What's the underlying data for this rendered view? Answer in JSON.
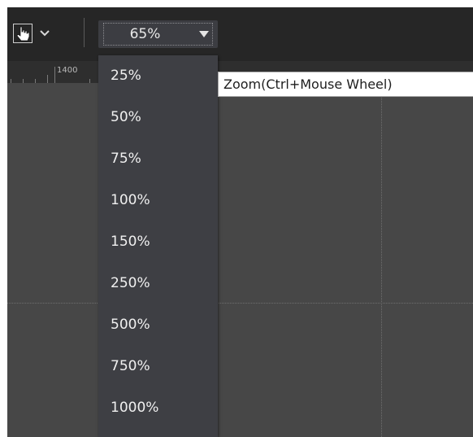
{
  "toolbar": {
    "pointer_tool_icon": "hand-pointer-icon",
    "pointer_dropdown_icon": "chevron-down-icon",
    "zoom": {
      "value": "65%",
      "arrow_icon": "triangle-down-icon"
    }
  },
  "ruler": {
    "label": "1400"
  },
  "zoom_menu": {
    "options": [
      "25%",
      "50%",
      "75%",
      "100%",
      "150%",
      "250%",
      "500%",
      "750%",
      "1000%"
    ]
  },
  "tooltip": {
    "text": "Zoom(Ctrl+Mouse Wheel)"
  },
  "colors": {
    "toolbar_bg": "#262626",
    "canvas_bg": "#474747",
    "dropdown_bg": "#3e3f44",
    "tooltip_bg": "#ffffff"
  }
}
